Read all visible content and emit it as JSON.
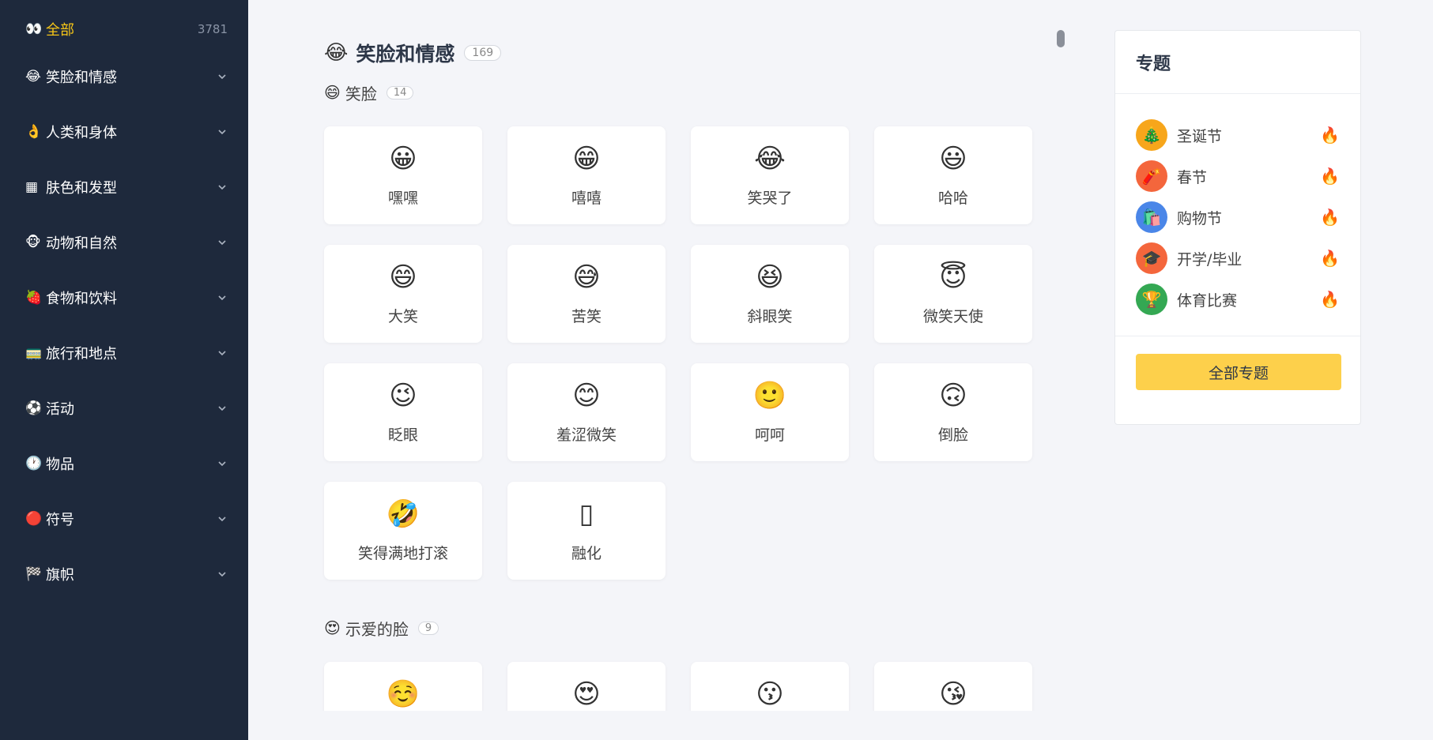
{
  "sidebar": {
    "items": [
      {
        "icon": "👀",
        "label": "全部",
        "count": "3781"
      },
      {
        "icon": "😂",
        "label": "笑脸和情感"
      },
      {
        "icon": "👌",
        "label": "人类和身体"
      },
      {
        "icon": "▦",
        "label": "肤色和发型"
      },
      {
        "icon": "🐵",
        "label": "动物和自然"
      },
      {
        "icon": "🍓",
        "label": "食物和饮料"
      },
      {
        "icon": "🚃",
        "label": "旅行和地点"
      },
      {
        "icon": "⚽",
        "label": "活动"
      },
      {
        "icon": "🕐",
        "label": "物品"
      },
      {
        "icon": "🔴",
        "label": "符号"
      },
      {
        "icon": "🏁",
        "label": "旗帜"
      }
    ]
  },
  "main": {
    "section": {
      "icon": "😂",
      "title": "笑脸和情感",
      "count": "169"
    },
    "groups": [
      {
        "icon": "😄",
        "title": "笑脸",
        "count": "14",
        "emojis": [
          {
            "char": "😀",
            "name": "嘿嘿"
          },
          {
            "char": "😁",
            "name": "嘻嘻"
          },
          {
            "char": "😂",
            "name": "笑哭了"
          },
          {
            "char": "😃",
            "name": "哈哈"
          },
          {
            "char": "😄",
            "name": "大笑"
          },
          {
            "char": "😅",
            "name": "苦笑"
          },
          {
            "char": "😆",
            "name": "斜眼笑"
          },
          {
            "char": "😇",
            "name": "微笑天使"
          },
          {
            "char": "😉",
            "name": "眨眼"
          },
          {
            "char": "😊",
            "name": "羞涩微笑"
          },
          {
            "char": "🙂",
            "name": "呵呵"
          },
          {
            "char": "🙃",
            "name": "倒脸"
          },
          {
            "char": "🤣",
            "name": "笑得满地打滚"
          },
          {
            "char": "▯",
            "name": "融化"
          }
        ]
      },
      {
        "icon": "😍",
        "title": "示爱的脸",
        "count": "9",
        "emojis": [
          {
            "char": "☺️",
            "name": ""
          },
          {
            "char": "😍",
            "name": ""
          },
          {
            "char": "😗",
            "name": ""
          },
          {
            "char": "😘",
            "name": ""
          }
        ]
      }
    ]
  },
  "topics": {
    "title": "专题",
    "items": [
      {
        "icon": "🎄",
        "label": "圣诞节",
        "color": "#f7a61b"
      },
      {
        "icon": "🧨",
        "label": "春节",
        "color": "#f4663c"
      },
      {
        "icon": "🛍️",
        "label": "购物节",
        "color": "#4a86e8"
      },
      {
        "icon": "🎓",
        "label": "开学/毕业",
        "color": "#f4663c"
      },
      {
        "icon": "🏆",
        "label": "体育比赛",
        "color": "#34a853"
      }
    ],
    "hot_icon": "🔥",
    "all_button": "全部专题"
  }
}
